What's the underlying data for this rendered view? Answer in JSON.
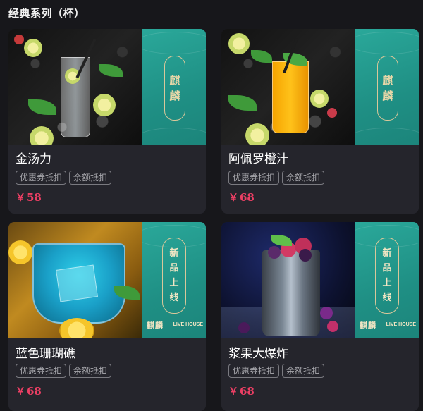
{
  "section": {
    "title": "经典系列（杯）"
  },
  "colors": {
    "price": "#ec3f64",
    "panel": "#23998d",
    "card_bg": "#25252c"
  },
  "products": [
    {
      "name": "金汤力",
      "tags": [
        "优惠券抵扣",
        "余额抵扣"
      ],
      "currency": "￥",
      "price": "58",
      "panel": {
        "type": "logo",
        "chars": [
          "麒",
          "麟"
        ]
      }
    },
    {
      "name": "阿佩罗橙汁",
      "tags": [
        "优惠券抵扣",
        "余额抵扣"
      ],
      "currency": "￥",
      "price": "68",
      "panel": {
        "type": "logo",
        "chars": [
          "麒",
          "麟"
        ]
      }
    },
    {
      "name": "蓝色珊瑚礁",
      "tags": [
        "优惠券抵扣",
        "余额抵扣"
      ],
      "currency": "￥",
      "price": "68",
      "panel": {
        "type": "new",
        "chars": [
          "新",
          "品",
          "上",
          "线"
        ],
        "brand_cn": "麒麟",
        "brand_en": "LIVE HOUSE"
      }
    },
    {
      "name": "浆果大爆炸",
      "tags": [
        "优惠券抵扣",
        "余额抵扣"
      ],
      "currency": "￥",
      "price": "68",
      "panel": {
        "type": "new",
        "chars": [
          "新",
          "品",
          "上",
          "线"
        ],
        "brand_cn": "麒麟",
        "brand_en": "LIVE HOUSE"
      }
    }
  ]
}
